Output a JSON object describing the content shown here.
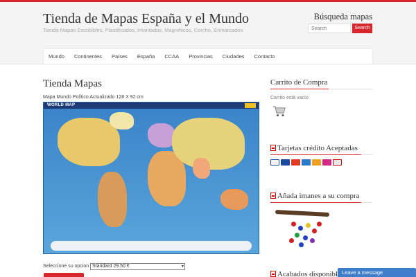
{
  "header": {
    "site_title": "Tienda de Mapas España y el Mundo",
    "site_description": "Tienda Mapas Escribibles, Plastificados, Imantados, Magnéticos, Corcho, Enmarcados",
    "search_title": "Búsqueda mapas",
    "search_placeholder": "Search",
    "search_button": "Search"
  },
  "nav": {
    "items": [
      {
        "label": "Mundo"
      },
      {
        "label": "Continentes"
      },
      {
        "label": "Países"
      },
      {
        "label": "España"
      },
      {
        "label": "CCAA"
      },
      {
        "label": "Provincias"
      },
      {
        "label": "Ciudades"
      },
      {
        "label": "Contacto"
      }
    ]
  },
  "main": {
    "page_title": "Tienda Mapas",
    "product_name": "Mapa Mundo Político Actualizado 128 X 92 cm",
    "map_title": "WORLD MAP",
    "option_label": "Seleccione su opcion :",
    "option_value": "Standard 29.50 €"
  },
  "sidebar": {
    "cart_title": "Carrito de Compra",
    "cart_empty": "Carrito está vacío",
    "cards_title": "Tarjetas crédito Aceptadas",
    "magnets_title": "Añada imanes a su compra",
    "finishes_title": "Acabados disponibles"
  },
  "chat": {
    "label": "Leave a message"
  },
  "colors": {
    "accent": "#d8272c",
    "chat": "#3e7ecb",
    "header_bg": "#f4f4f4"
  }
}
